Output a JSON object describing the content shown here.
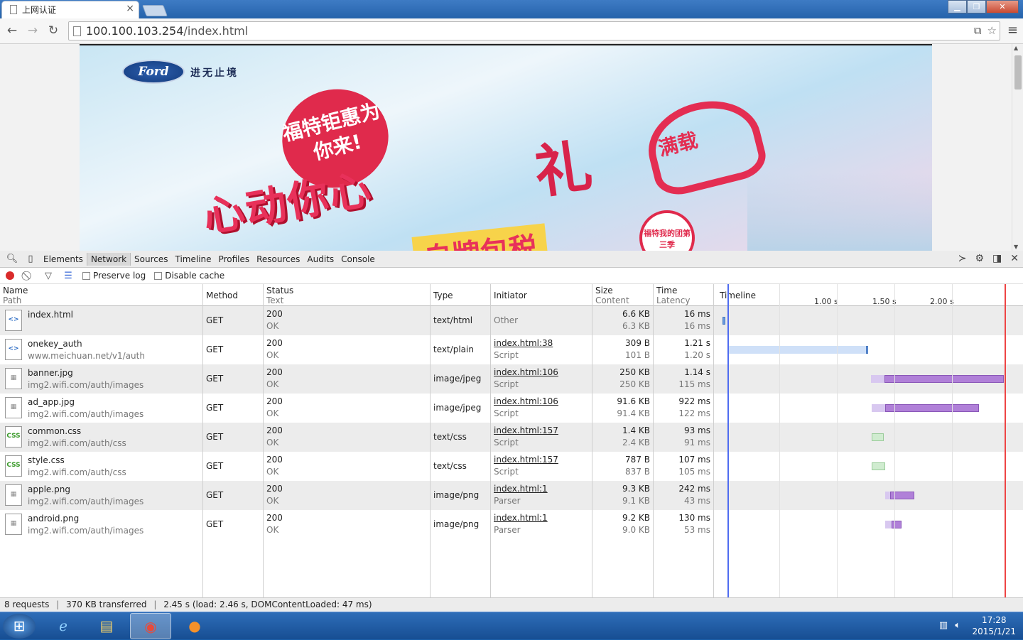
{
  "browser": {
    "tab_title": "上网认证",
    "tab_close": "×",
    "url_host": "100.100.103.254",
    "url_path": "/index.html",
    "back_icon": "←",
    "forward_icon": "→",
    "reload_icon": "↻",
    "menu_icon": "≡",
    "star_icon": "☆",
    "translate_icon": "⧉",
    "window_min": "▁",
    "window_max": "❐",
    "window_close": "✕"
  },
  "banner": {
    "brand_logo": "Ford",
    "brand_slogan": "进无止境",
    "bubble_text": "福特钜惠为你来!",
    "headline": "心动你心",
    "gift_text": "礼",
    "heart_text": "满载",
    "tax_text": "自牌包税",
    "seal_text": "福特我的团第三季"
  },
  "devtools": {
    "tabs": [
      "Elements",
      "Network",
      "Sources",
      "Timeline",
      "Profiles",
      "Resources",
      "Audits",
      "Console"
    ],
    "active_tab": "Network",
    "preserve_log": "Preserve log",
    "disable_cache": "Disable cache",
    "columns": {
      "name": "Name",
      "name_sub": "Path",
      "method": "Method",
      "status": "Status",
      "status_sub": "Text",
      "type": "Type",
      "initiator": "Initiator",
      "size": "Size",
      "size_sub": "Content",
      "time": "Time",
      "time_sub": "Latency",
      "timeline": "Timeline"
    },
    "timeline_ticks": [
      "1.00 s",
      "1.50 s",
      "2.00 s"
    ],
    "rows": [
      {
        "name": "index.html",
        "path": "",
        "icon": "html-file-icon",
        "method": "GET",
        "status": "200",
        "status_text": "OK",
        "type": "text/html",
        "initiator": "Other",
        "initiator_sub": "",
        "size": "6.6 KB",
        "content": "6.3 KB",
        "time": "16 ms",
        "latency": "16 ms"
      },
      {
        "name": "onekey_auth",
        "path": "www.meichuan.net/v1/auth",
        "icon": "html-file-icon",
        "method": "GET",
        "status": "200",
        "status_text": "OK",
        "type": "text/plain",
        "initiator": "index.html:38",
        "initiator_sub": "Script",
        "size": "309 B",
        "content": "101 B",
        "time": "1.21 s",
        "latency": "1.20 s"
      },
      {
        "name": "banner.jpg",
        "path": "img2.wifi.com/auth/images",
        "icon": "image-file-icon",
        "method": "GET",
        "status": "200",
        "status_text": "OK",
        "type": "image/jpeg",
        "initiator": "index.html:106",
        "initiator_sub": "Script",
        "size": "250 KB",
        "content": "250 KB",
        "time": "1.14 s",
        "latency": "115 ms"
      },
      {
        "name": "ad_app.jpg",
        "path": "img2.wifi.com/auth/images",
        "icon": "image-file-icon",
        "method": "GET",
        "status": "200",
        "status_text": "OK",
        "type": "image/jpeg",
        "initiator": "index.html:106",
        "initiator_sub": "Script",
        "size": "91.6 KB",
        "content": "91.4 KB",
        "time": "922 ms",
        "latency": "122 ms"
      },
      {
        "name": "common.css",
        "path": "img2.wifi.com/auth/css",
        "icon": "css-file-icon",
        "method": "GET",
        "status": "200",
        "status_text": "OK",
        "type": "text/css",
        "initiator": "index.html:157",
        "initiator_sub": "Script",
        "size": "1.4 KB",
        "content": "2.4 KB",
        "time": "93 ms",
        "latency": "91 ms"
      },
      {
        "name": "style.css",
        "path": "img2.wifi.com/auth/css",
        "icon": "css-file-icon",
        "method": "GET",
        "status": "200",
        "status_text": "OK",
        "type": "text/css",
        "initiator": "index.html:157",
        "initiator_sub": "Script",
        "size": "787 B",
        "content": "837 B",
        "time": "107 ms",
        "latency": "105 ms"
      },
      {
        "name": "apple.png",
        "path": "img2.wifi.com/auth/images",
        "icon": "image-file-icon",
        "method": "GET",
        "status": "200",
        "status_text": "OK",
        "type": "image/png",
        "initiator": "index.html:1",
        "initiator_sub": "Parser",
        "size": "9.3 KB",
        "content": "9.1 KB",
        "time": "242 ms",
        "latency": "43 ms"
      },
      {
        "name": "android.png",
        "path": "img2.wifi.com/auth/images",
        "icon": "image-file-icon",
        "method": "GET",
        "status": "200",
        "status_text": "OK",
        "type": "image/png",
        "initiator": "index.html:1",
        "initiator_sub": "Parser",
        "size": "9.2 KB",
        "content": "9.0 KB",
        "time": "130 ms",
        "latency": "53 ms"
      }
    ],
    "status_summary": {
      "requests": "8 requests",
      "transferred": "370 KB transferred",
      "timing": "2.45 s (load: 2.46 s, DOMContentLoaded: 47 ms)"
    }
  },
  "taskbar": {
    "start_icon": "windows-start-icon",
    "apps": [
      "internet-explorer-icon",
      "file-explorer-icon",
      "chrome-icon",
      "firefox-icon"
    ],
    "time": "17:28",
    "date": "2015/1/21"
  }
}
